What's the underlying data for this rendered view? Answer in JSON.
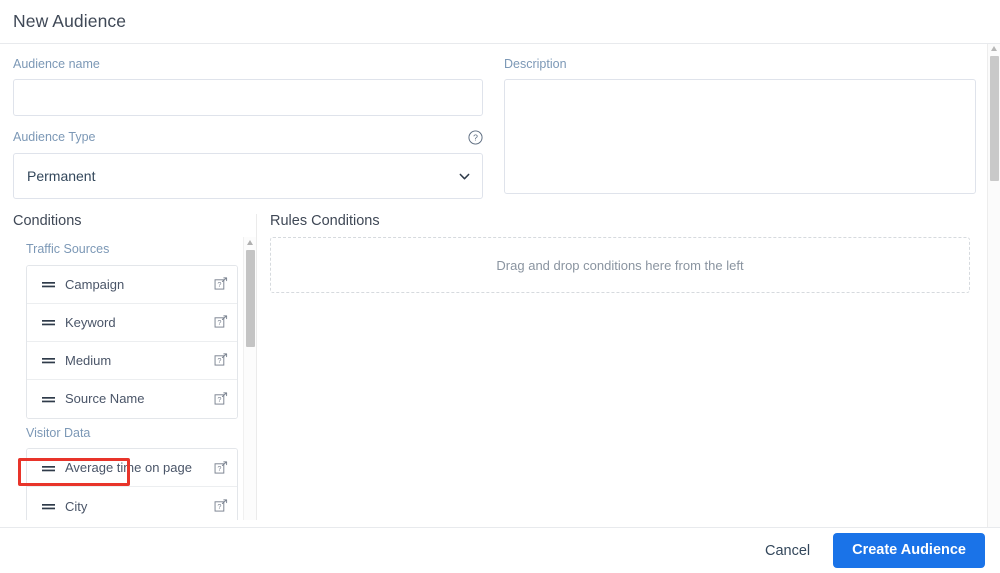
{
  "dialog": {
    "title": "New Audience"
  },
  "form": {
    "audience_name": {
      "label": "Audience name",
      "value": "",
      "placeholder": ""
    },
    "description": {
      "label": "Description",
      "value": "",
      "placeholder": ""
    },
    "audience_type": {
      "label": "Audience Type",
      "help_icon": "help-circle-icon",
      "selected": "Permanent",
      "options": [
        "Permanent"
      ],
      "chevron_icon": "chevron-down-icon"
    }
  },
  "conditions": {
    "heading": "Conditions",
    "groups": [
      {
        "label": "Traffic Sources",
        "highlighted": true,
        "items": [
          {
            "label": "Campaign",
            "drag_icon": "drag-handle-icon",
            "info_icon": "knowledge-base-icon"
          },
          {
            "label": "Keyword",
            "drag_icon": "drag-handle-icon",
            "info_icon": "knowledge-base-icon"
          },
          {
            "label": "Medium",
            "drag_icon": "drag-handle-icon",
            "info_icon": "knowledge-base-icon"
          },
          {
            "label": "Source Name",
            "drag_icon": "drag-handle-icon",
            "info_icon": "knowledge-base-icon"
          }
        ]
      },
      {
        "label": "Visitor Data",
        "highlighted": false,
        "items": [
          {
            "label": "Average time on page",
            "drag_icon": "drag-handle-icon",
            "info_icon": "knowledge-base-icon"
          },
          {
            "label": "City",
            "drag_icon": "drag-handle-icon",
            "info_icon": "knowledge-base-icon"
          }
        ]
      }
    ]
  },
  "rules": {
    "heading": "Rules Conditions",
    "dropzone_text": "Drag and drop conditions here from the left"
  },
  "footer": {
    "cancel_label": "Cancel",
    "primary_label": "Create Audience"
  },
  "colors": {
    "primary": "#1a73e8",
    "annotation": "#e8342a",
    "label_text": "#7c98b6",
    "body_text": "#33475b",
    "border": "#dfe3eb"
  }
}
